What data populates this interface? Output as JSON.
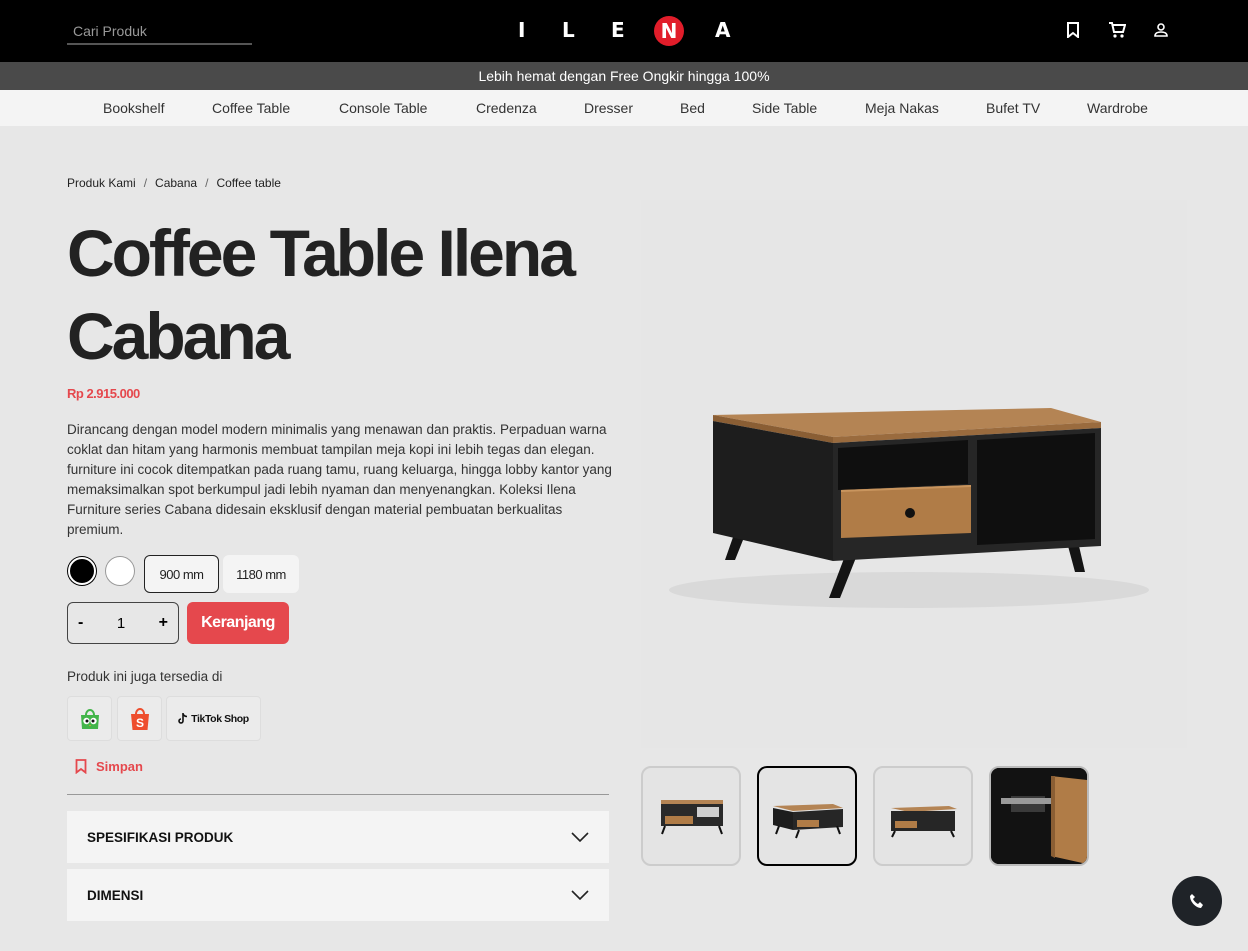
{
  "header": {
    "search_placeholder": "Cari Produk",
    "logo_letters": [
      "I",
      "L",
      "E",
      "N",
      "A"
    ]
  },
  "promo": "Lebih hemat dengan Free Ongkir hingga 100%",
  "categories": [
    "Bookshelf",
    "Coffee Table",
    "Console Table",
    "Credenza",
    "Dresser",
    "Bed",
    "Side Table",
    "Meja Nakas",
    "Bufet TV",
    "Wardrobe"
  ],
  "breadcrumb": [
    "Produk Kami",
    "Cabana",
    "Coffee table"
  ],
  "product": {
    "title": "Coffee Table Ilena Cabana",
    "price": "Rp 2.915.000",
    "description": "Dirancang dengan model modern minimalis yang menawan dan praktis. Perpaduan warna coklat dan hitam yang harmonis membuat tampilan meja kopi ini lebih tegas dan elegan. furniture ini cocok ditempatkan pada ruang tamu, ruang keluarga, hingga lobby kantor yang memaksimalkan spot berkumpul jadi lebih nyaman dan menyenangkan. Koleksi Ilena Furniture series Cabana didesain eksklusif dengan material pembuatan berkualitas premium.",
    "colors": [
      "#000000",
      "#ffffff"
    ],
    "sizes": [
      "900 mm",
      "1180 mm"
    ],
    "quantity": "1",
    "minus": "-",
    "plus": "+",
    "cart_label": "Keranjang",
    "available_label": "Produk ini juga tersedia di",
    "marketplaces": [
      "tokopedia-icon",
      "shopee-icon",
      "TikTok Shop"
    ],
    "save_label": "Simpan",
    "accordions": [
      "SPESIFIKASI PRODUK",
      "DIMENSI"
    ]
  },
  "colors": {
    "accent": "#e5484d",
    "brand_n": "#e11d2a",
    "header_bg": "#000000",
    "promo_bg": "#4a4a4a"
  }
}
